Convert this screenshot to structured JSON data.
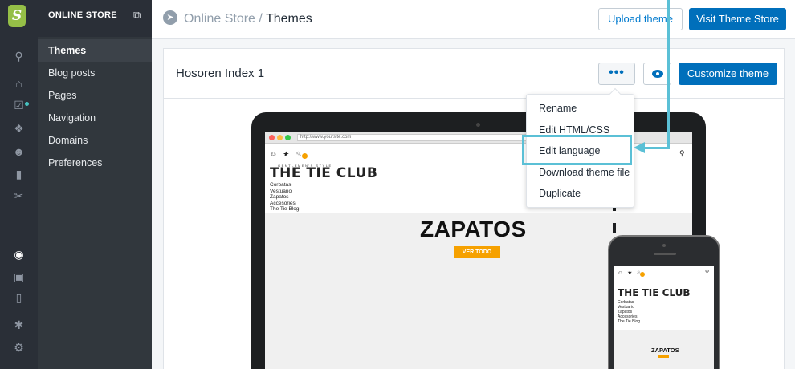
{
  "rail": {
    "logo_letter": "S",
    "icons": [
      "search-icon",
      "home-icon",
      "orders-icon",
      "tag-icon",
      "customers-icon",
      "analytics-icon",
      "discounts-icon",
      "globe-icon",
      "facebook-icon",
      "mobile-icon",
      "apps-icon",
      "settings-icon"
    ]
  },
  "sidebar": {
    "title": "ONLINE STORE",
    "items": [
      {
        "label": "Themes",
        "active": true
      },
      {
        "label": "Blog posts"
      },
      {
        "label": "Pages"
      },
      {
        "label": "Navigation"
      },
      {
        "label": "Domains"
      },
      {
        "label": "Preferences"
      }
    ]
  },
  "topbar": {
    "breadcrumb_parent": "Online Store",
    "breadcrumb_sep": " / ",
    "breadcrumb_current": "Themes",
    "upload_label": "Upload theme",
    "visit_label": "Visit Theme Store"
  },
  "card": {
    "title": "Hosoren Index 1",
    "more_label": "•••",
    "customize_label": "Customize theme"
  },
  "dropdown": {
    "items": [
      "Rename",
      "Edit HTML/CSS",
      "Edit language",
      "Download theme file",
      "Duplicate"
    ],
    "highlighted": "Edit language"
  },
  "preview": {
    "url": "http://www.yoursite.com",
    "logo_tagline": "GENTLEMEN'S STYLE",
    "logo": "THE TIE CLUB",
    "menu": [
      "Corbatas",
      "Vestuario",
      "Zapatos",
      "Accesories",
      "The Tie Blog"
    ],
    "hero_title": "ZAPATOS",
    "hero_button": "VER TODO"
  },
  "colors": {
    "accent": "#006fbb",
    "annotation": "#5bc0d6",
    "sidebar": "#31373d",
    "hero_button": "#f6a100"
  }
}
